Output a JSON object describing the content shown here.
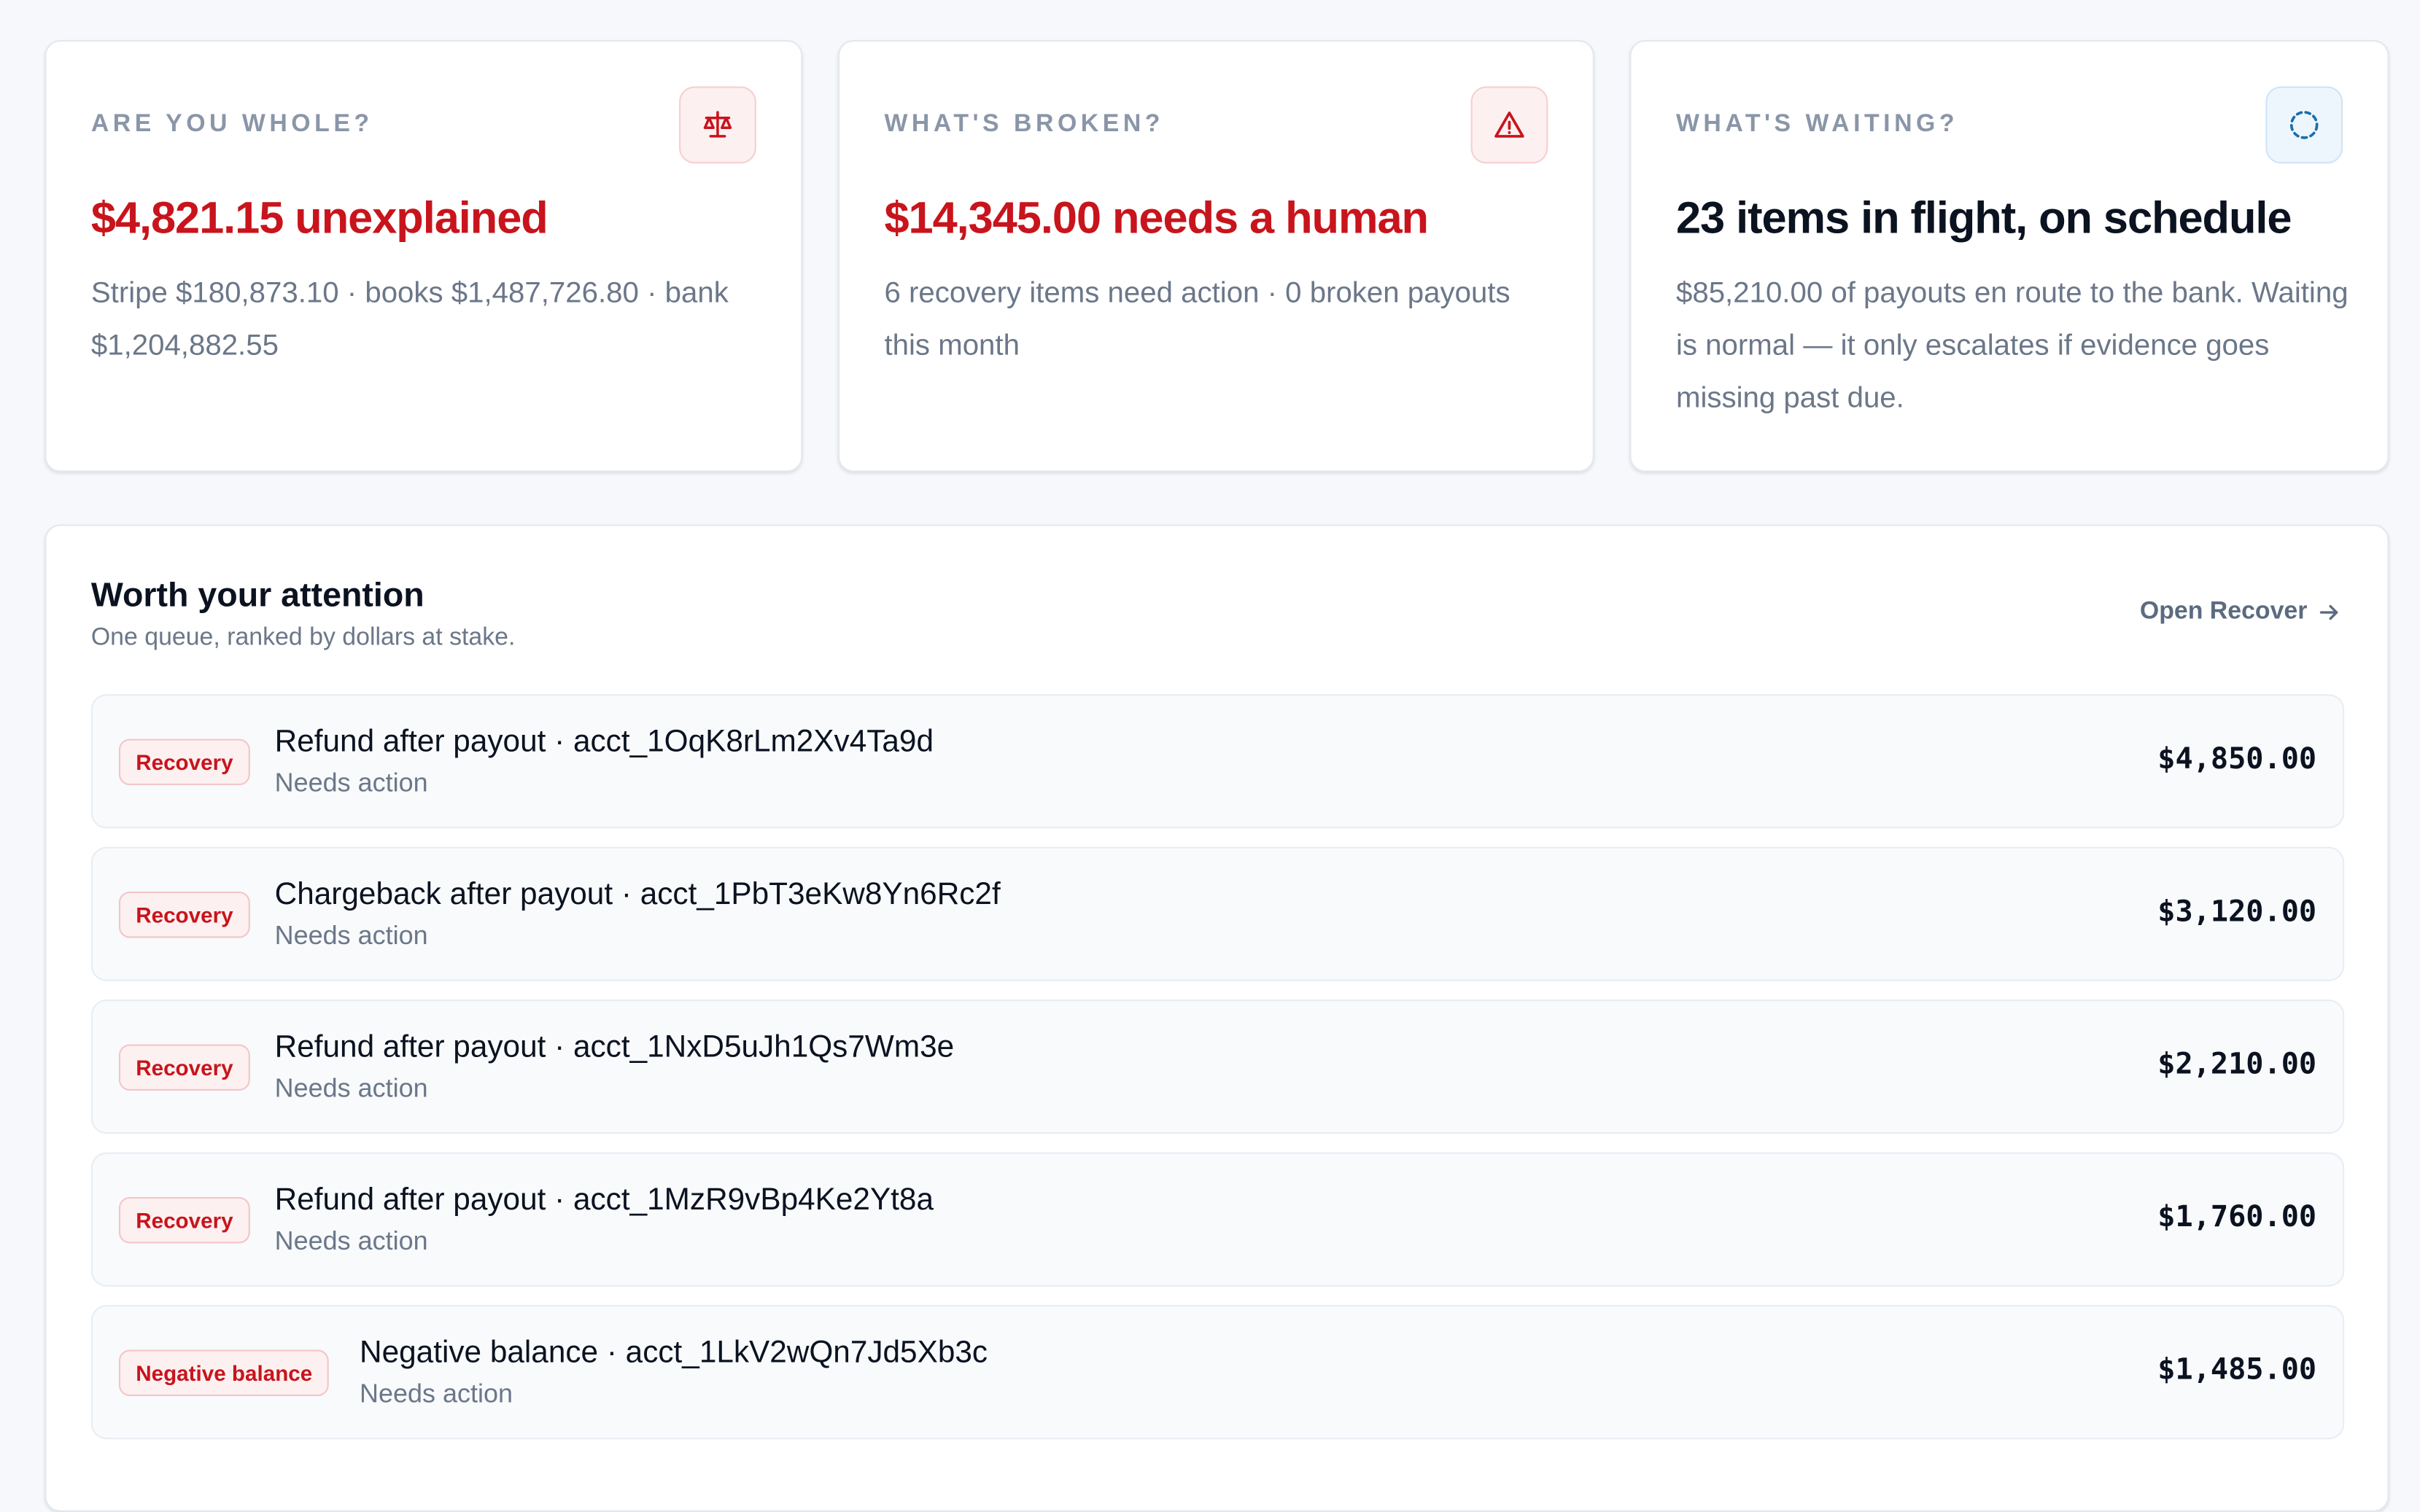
{
  "colors": {
    "danger": "#c8141c",
    "info": "#1b6fa8",
    "muted": "#6b7789",
    "page_background": "#f6f8fb"
  },
  "metrics": [
    {
      "eyebrow": "ARE YOU WHOLE?",
      "icon": "scale-icon",
      "tone": "danger",
      "headline": "$4,821.15 unexplained",
      "detail": "Stripe $180,873.10 · books $1,487,726.80 · bank $1,204,882.55"
    },
    {
      "eyebrow": "WHAT'S BROKEN?",
      "icon": "warning-triangle-icon",
      "tone": "danger",
      "headline": "$14,345.00 needs a human",
      "detail": "6 recovery items need action · 0 broken payouts this month"
    },
    {
      "eyebrow": "WHAT'S WAITING?",
      "icon": "dashed-circle-icon",
      "tone": "info",
      "headline": "23 items in flight, on schedule",
      "detail": "$85,210.00 of payouts en route to the bank. Waiting is normal — it only escalates if evidence goes missing past due."
    }
  ],
  "queue": {
    "title": "Worth your attention",
    "subtitle": "One queue, ranked by dollars at stake.",
    "open_link": "Open Recover",
    "open_link_icon": "arrow-right-icon",
    "items": [
      {
        "badge": "Recovery",
        "title": "Refund after payout · acct_1OqK8rLm2Xv4Ta9d",
        "status": "Needs action",
        "amount": "$4,850.00"
      },
      {
        "badge": "Recovery",
        "title": "Chargeback after payout · acct_1PbT3eKw8Yn6Rc2f",
        "status": "Needs action",
        "amount": "$3,120.00"
      },
      {
        "badge": "Recovery",
        "title": "Refund after payout · acct_1NxD5uJh1Qs7Wm3e",
        "status": "Needs action",
        "amount": "$2,210.00"
      },
      {
        "badge": "Recovery",
        "title": "Refund after payout · acct_1MzR9vBp4Ke2Yt8a",
        "status": "Needs action",
        "amount": "$1,760.00"
      },
      {
        "badge": "Negative balance",
        "title": "Negative balance · acct_1LkV2wQn7Jd5Xb3c",
        "status": "Needs action",
        "amount": "$1,485.00"
      }
    ]
  }
}
